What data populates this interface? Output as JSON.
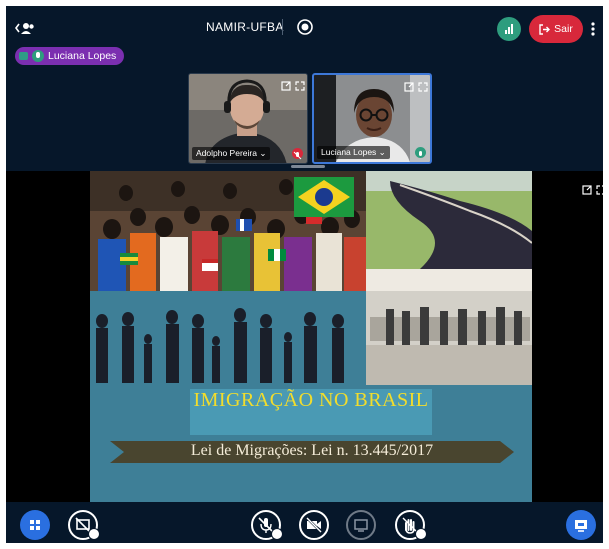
{
  "header": {
    "meeting_title": "NAMIR-UFBA",
    "leave_label": "Sair",
    "icons": {
      "users": "users-icon",
      "record": "record-icon",
      "connection": "signal-icon",
      "leave": "exit-icon",
      "options": "more-vertical-icon"
    }
  },
  "talking_indicator": {
    "name": "Luciana Lopes",
    "color": "#7b2fb0"
  },
  "video_tiles": [
    {
      "name": "Adolpho Pereira",
      "mic_state": "muted",
      "mic_color": "#d8283b"
    },
    {
      "name": "Luciana Lopes",
      "mic_state": "talking",
      "mic_color": "#2e9d7e"
    }
  ],
  "presentation": {
    "slide_title": "IMIGRAÇÃO NO BRASIL",
    "slide_subtitle": "Lei de Migrações: Lei n. 13.445/2017"
  },
  "controls": {
    "left": [
      "actions-icon",
      "screen-share-off-icon"
    ],
    "center": [
      "mic-off-icon",
      "camera-off-icon",
      "share-screen-icon",
      "raise-hand-off-icon"
    ],
    "right": [
      "presentation-restore-icon"
    ]
  },
  "colors": {
    "background": "#06172a",
    "primary": "#2a6fe0",
    "danger": "#d8283b",
    "success": "#2e9d7e",
    "slide_title": "#f2dd2c"
  }
}
